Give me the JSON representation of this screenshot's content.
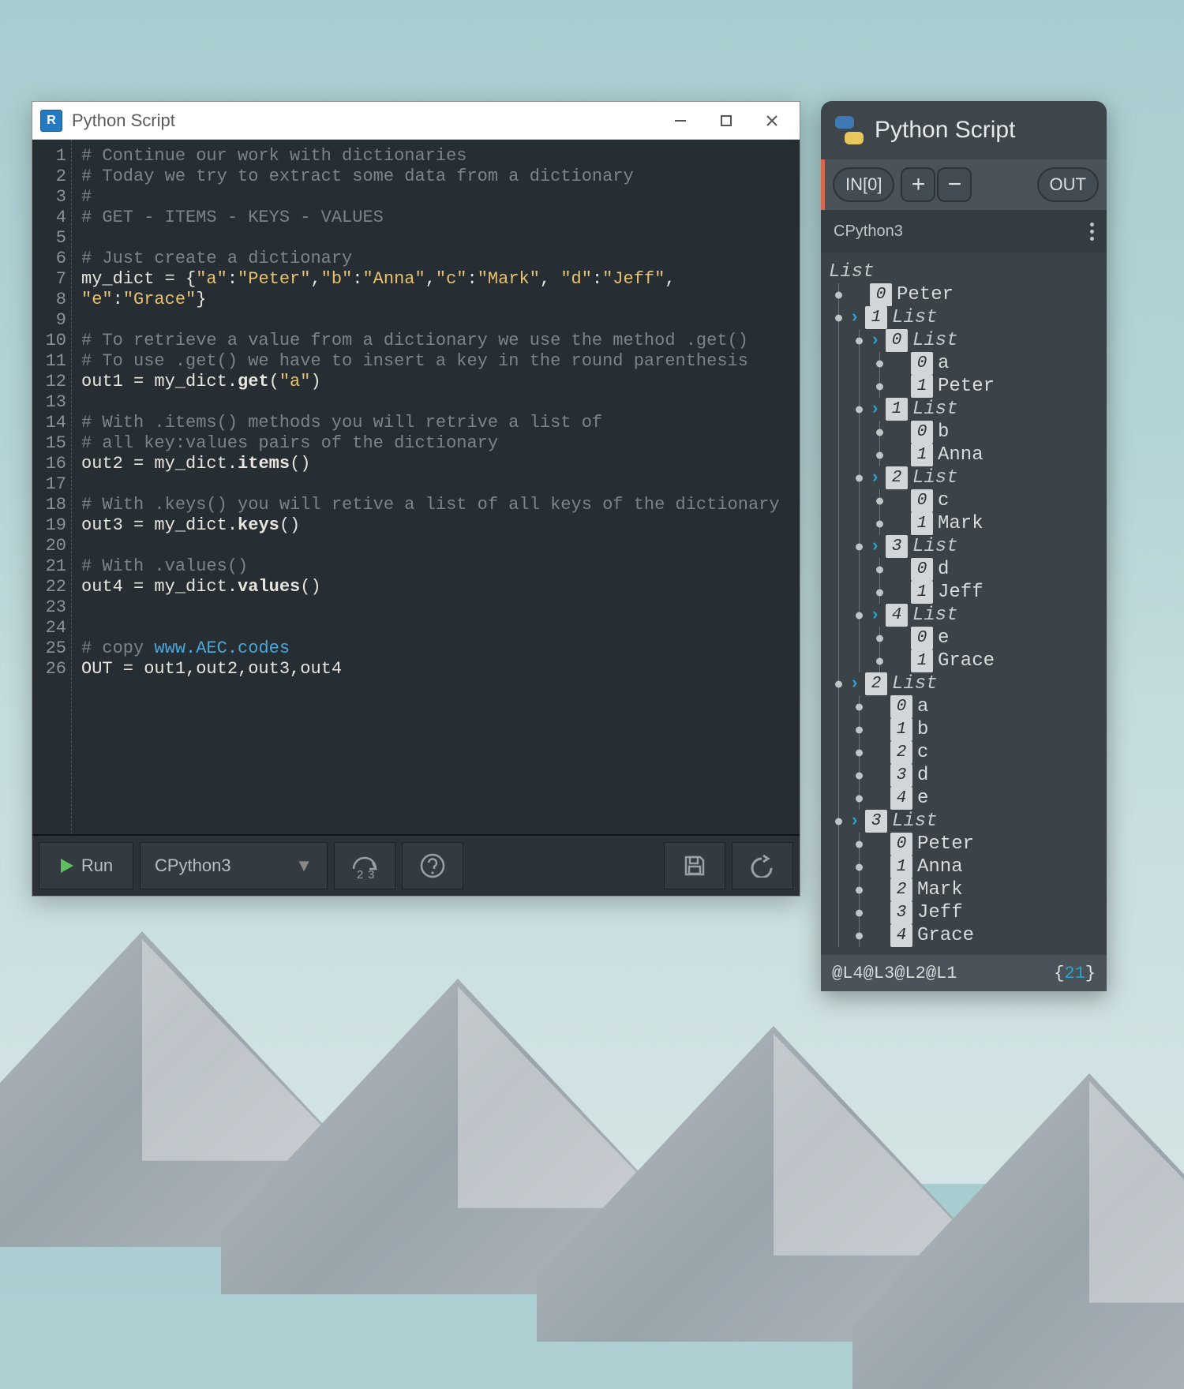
{
  "editor": {
    "title": "Python Script",
    "app_icon_letter": "R",
    "lines": [
      {
        "n": 1,
        "segs": [
          {
            "cls": "c-comment",
            "t": "# Continue our work with dictionaries"
          }
        ]
      },
      {
        "n": 2,
        "segs": [
          {
            "cls": "c-comment",
            "t": "# Today we try to extract some data from a dictionary"
          }
        ]
      },
      {
        "n": 3,
        "segs": [
          {
            "cls": "c-comment",
            "t": "#"
          }
        ]
      },
      {
        "n": 4,
        "segs": [
          {
            "cls": "c-comment",
            "t": "# GET - ITEMS - KEYS - VALUES"
          }
        ]
      },
      {
        "n": 5,
        "segs": []
      },
      {
        "n": 6,
        "segs": [
          {
            "cls": "c-comment",
            "t": "# Just create a dictionary"
          }
        ]
      },
      {
        "n": 7,
        "segs": [
          {
            "cls": "",
            "t": "my_dict = {"
          },
          {
            "cls": "c-str",
            "t": "\"a\""
          },
          {
            "cls": "",
            "t": ":"
          },
          {
            "cls": "c-str",
            "t": "\"Peter\""
          },
          {
            "cls": "",
            "t": ","
          },
          {
            "cls": "c-str",
            "t": "\"b\""
          },
          {
            "cls": "",
            "t": ":"
          },
          {
            "cls": "c-str",
            "t": "\"Anna\""
          },
          {
            "cls": "",
            "t": ","
          },
          {
            "cls": "c-str",
            "t": "\"c\""
          },
          {
            "cls": "",
            "t": ":"
          },
          {
            "cls": "c-str",
            "t": "\"Mark\""
          },
          {
            "cls": "",
            "t": ", "
          },
          {
            "cls": "c-str",
            "t": "\"d\""
          },
          {
            "cls": "",
            "t": ":"
          },
          {
            "cls": "c-str",
            "t": "\"Jeff\""
          },
          {
            "cls": "",
            "t": ","
          }
        ]
      },
      {
        "n": 8,
        "segs": [
          {
            "cls": "c-str",
            "t": "\"e\""
          },
          {
            "cls": "",
            "t": ":"
          },
          {
            "cls": "c-str",
            "t": "\"Grace\""
          },
          {
            "cls": "",
            "t": "}"
          }
        ]
      },
      {
        "n": 9,
        "segs": []
      },
      {
        "n": 10,
        "segs": [
          {
            "cls": "c-comment",
            "t": "# To retrieve a value from a dictionary we use the method .get()"
          }
        ]
      },
      {
        "n": 11,
        "segs": [
          {
            "cls": "c-comment",
            "t": "# To use .get() we have to insert a key in the round parenthesis"
          }
        ]
      },
      {
        "n": 12,
        "segs": [
          {
            "cls": "",
            "t": "out1 = my_dict."
          },
          {
            "cls": "c-func",
            "t": "get"
          },
          {
            "cls": "",
            "t": "("
          },
          {
            "cls": "c-str",
            "t": "\"a\""
          },
          {
            "cls": "",
            "t": ")"
          }
        ]
      },
      {
        "n": 13,
        "segs": []
      },
      {
        "n": 14,
        "segs": [
          {
            "cls": "c-comment",
            "t": "# With .items() methods you will retrive a list of"
          }
        ]
      },
      {
        "n": 15,
        "segs": [
          {
            "cls": "c-comment",
            "t": "# all key:values pairs of the dictionary"
          }
        ]
      },
      {
        "n": 16,
        "segs": [
          {
            "cls": "",
            "t": "out2 = my_dict."
          },
          {
            "cls": "c-func",
            "t": "items"
          },
          {
            "cls": "",
            "t": "()"
          }
        ]
      },
      {
        "n": 17,
        "segs": []
      },
      {
        "n": 18,
        "segs": [
          {
            "cls": "c-comment",
            "t": "# With .keys() you will retive a list of all keys of the dictionary"
          }
        ]
      },
      {
        "n": 19,
        "segs": [
          {
            "cls": "",
            "t": "out3 = my_dict."
          },
          {
            "cls": "c-func",
            "t": "keys"
          },
          {
            "cls": "",
            "t": "()"
          }
        ]
      },
      {
        "n": 20,
        "segs": []
      },
      {
        "n": 21,
        "segs": [
          {
            "cls": "c-comment",
            "t": "# With .values()"
          }
        ]
      },
      {
        "n": 22,
        "segs": [
          {
            "cls": "",
            "t": "out4 = my_dict."
          },
          {
            "cls": "c-func",
            "t": "values"
          },
          {
            "cls": "",
            "t": "()"
          }
        ]
      },
      {
        "n": 23,
        "segs": []
      },
      {
        "n": 24,
        "segs": []
      },
      {
        "n": 25,
        "segs": [
          {
            "cls": "c-comment",
            "t": "# copy "
          },
          {
            "cls": "c-link",
            "t": "www.AEC.codes"
          }
        ]
      },
      {
        "n": 26,
        "segs": [
          {
            "cls": "",
            "t": "OUT = out1,out2,out3,out4"
          }
        ]
      }
    ],
    "toolbar": {
      "run_label": "Run",
      "engine": "CPython3"
    }
  },
  "node": {
    "title": "Python Script",
    "in_label": "IN[0]",
    "out_label": "OUT",
    "engine_label": "CPython3",
    "footer_levels": "@L4@L3@L2@L1",
    "footer_count": "21",
    "tree": [
      {
        "depth": 0,
        "caret": false,
        "idx": null,
        "label": "List",
        "isList": true
      },
      {
        "depth": 1,
        "caret": false,
        "idx": "0",
        "label": "Peter"
      },
      {
        "depth": 1,
        "caret": true,
        "idx": "1",
        "label": "List",
        "isList": true
      },
      {
        "depth": 2,
        "caret": true,
        "idx": "0",
        "label": "List",
        "isList": true
      },
      {
        "depth": 3,
        "caret": false,
        "idx": "0",
        "label": "a"
      },
      {
        "depth": 3,
        "caret": false,
        "idx": "1",
        "label": "Peter"
      },
      {
        "depth": 2,
        "caret": true,
        "idx": "1",
        "label": "List",
        "isList": true
      },
      {
        "depth": 3,
        "caret": false,
        "idx": "0",
        "label": "b"
      },
      {
        "depth": 3,
        "caret": false,
        "idx": "1",
        "label": "Anna"
      },
      {
        "depth": 2,
        "caret": true,
        "idx": "2",
        "label": "List",
        "isList": true
      },
      {
        "depth": 3,
        "caret": false,
        "idx": "0",
        "label": "c"
      },
      {
        "depth": 3,
        "caret": false,
        "idx": "1",
        "label": "Mark"
      },
      {
        "depth": 2,
        "caret": true,
        "idx": "3",
        "label": "List",
        "isList": true
      },
      {
        "depth": 3,
        "caret": false,
        "idx": "0",
        "label": "d"
      },
      {
        "depth": 3,
        "caret": false,
        "idx": "1",
        "label": "Jeff"
      },
      {
        "depth": 2,
        "caret": true,
        "idx": "4",
        "label": "List",
        "isList": true
      },
      {
        "depth": 3,
        "caret": false,
        "idx": "0",
        "label": "e"
      },
      {
        "depth": 3,
        "caret": false,
        "idx": "1",
        "label": "Grace"
      },
      {
        "depth": 1,
        "caret": true,
        "idx": "2",
        "label": "List",
        "isList": true
      },
      {
        "depth": 2,
        "caret": false,
        "idx": "0",
        "label": "a"
      },
      {
        "depth": 2,
        "caret": false,
        "idx": "1",
        "label": "b"
      },
      {
        "depth": 2,
        "caret": false,
        "idx": "2",
        "label": "c"
      },
      {
        "depth": 2,
        "caret": false,
        "idx": "3",
        "label": "d"
      },
      {
        "depth": 2,
        "caret": false,
        "idx": "4",
        "label": "e"
      },
      {
        "depth": 1,
        "caret": true,
        "idx": "3",
        "label": "List",
        "isList": true
      },
      {
        "depth": 2,
        "caret": false,
        "idx": "0",
        "label": "Peter"
      },
      {
        "depth": 2,
        "caret": false,
        "idx": "1",
        "label": "Anna"
      },
      {
        "depth": 2,
        "caret": false,
        "idx": "2",
        "label": "Mark"
      },
      {
        "depth": 2,
        "caret": false,
        "idx": "3",
        "label": "Jeff"
      },
      {
        "depth": 2,
        "caret": false,
        "idx": "4",
        "label": "Grace"
      }
    ]
  }
}
